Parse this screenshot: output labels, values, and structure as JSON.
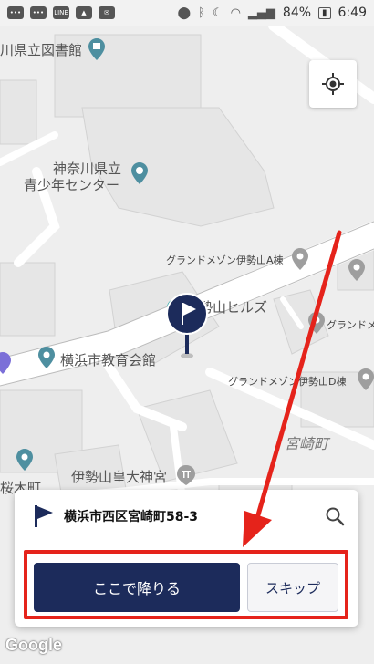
{
  "status_bar": {
    "notification_icons": [
      "chat-icon",
      "chat-icon",
      "line-app-icon",
      "image-icon",
      "mail-icon"
    ],
    "battery_label": "84%",
    "time": "6:49"
  },
  "map": {
    "labels": {
      "library": "川県立図書館",
      "youth_center_line1": "神奈川県立",
      "youth_center_line2": "青少年センター",
      "mansion_a": "グランドメゾン伊勢山A棟",
      "hills": "伊勢山ヒルズ",
      "mansion_b": "グランドメゾ",
      "education_hall": "横浜市教育会館",
      "mansion_d": "グランドメゾン伊勢山D棟",
      "district": "宮崎町",
      "shrine": "伊勢山皇大神宮",
      "edge_left": "桜木町"
    },
    "google_label": "Google"
  },
  "panel": {
    "address": "横浜市西区宮崎町58-3",
    "primary_button": "ここで降りる",
    "secondary_button": "スキップ"
  },
  "colors": {
    "primary": "#1c2b5b",
    "highlight": "#e5231b",
    "poi_teal": "#4e8fa0"
  }
}
